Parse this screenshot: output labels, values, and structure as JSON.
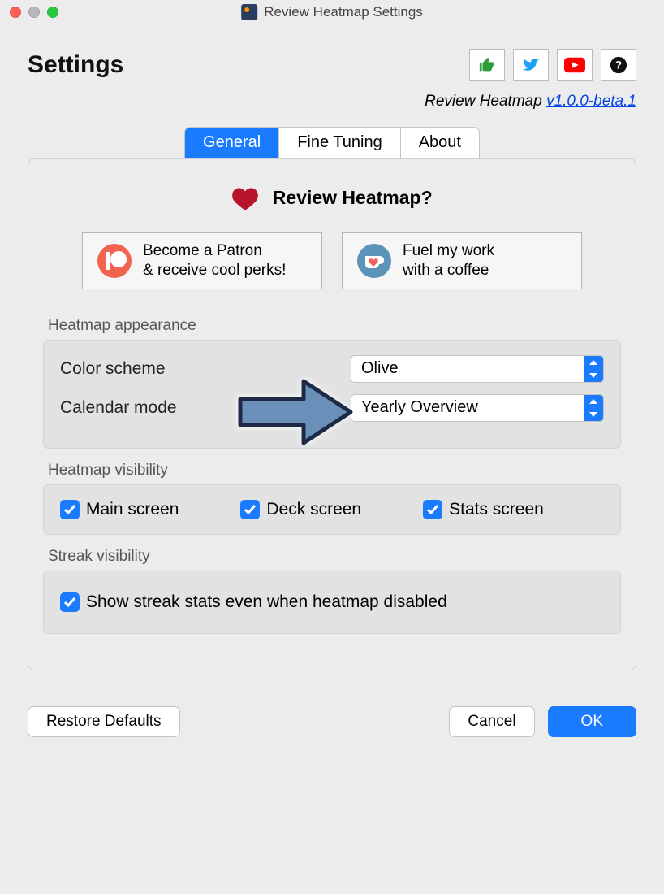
{
  "window_title": "Review Heatmap Settings",
  "page_title": "Settings",
  "version": {
    "name": "Review Heatmap",
    "version": "v1.0.0-beta.1"
  },
  "header_icons": [
    "thumbs-up",
    "twitter",
    "youtube",
    "help"
  ],
  "tabs": [
    {
      "label": "General",
      "active": true
    },
    {
      "label": "Fine Tuning",
      "active": false
    },
    {
      "label": "About",
      "active": false
    }
  ],
  "love_prompt": "Review Heatmap?",
  "promos": [
    {
      "icon": "patreon",
      "line1": "Become a Patron",
      "line2": "& receive cool perks!"
    },
    {
      "icon": "kofi",
      "line1": "Fuel my work",
      "line2": "with a coffee"
    }
  ],
  "sections": {
    "appearance": {
      "label": "Heatmap appearance",
      "rows": {
        "color_scheme": {
          "label": "Color scheme",
          "value": "Olive"
        },
        "calendar_mode": {
          "label": "Calendar mode",
          "value": "Yearly Overview"
        }
      }
    },
    "visibility": {
      "label": "Heatmap visibility",
      "checks": [
        {
          "label": "Main screen",
          "checked": true
        },
        {
          "label": "Deck screen",
          "checked": true
        },
        {
          "label": "Stats screen",
          "checked": true
        }
      ]
    },
    "streak": {
      "label": "Streak visibility",
      "check": {
        "label": "Show streak stats even when heatmap disabled",
        "checked": true
      }
    }
  },
  "footer": {
    "restore": "Restore Defaults",
    "cancel": "Cancel",
    "ok": "OK"
  },
  "annotation": "arrow-pointing-to-calendar-mode"
}
